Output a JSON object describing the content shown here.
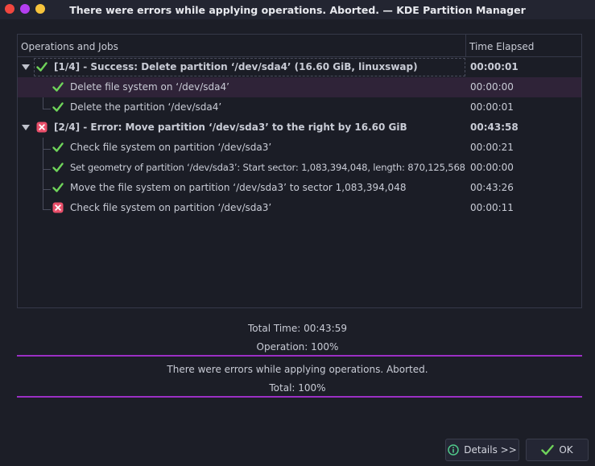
{
  "window": {
    "title": "There were errors while applying operations. Aborted. — KDE Partition Manager"
  },
  "table": {
    "col_operations": "Operations and Jobs",
    "col_time": "Time Elapsed"
  },
  "rows": [
    {
      "text": "[1/4] - Success: Delete partition ‘/dev/sda4’ (16.60 GiB, linuxswap)",
      "time": "00:00:01",
      "status": "success",
      "level": 0
    },
    {
      "text": "Delete file system on ‘/dev/sda4’",
      "time": "00:00:00",
      "status": "success",
      "level": 1
    },
    {
      "text": "Delete the partition ‘/dev/sda4’",
      "time": "00:00:01",
      "status": "success",
      "level": 1
    },
    {
      "text": "[2/4] - Error: Move partition ‘/dev/sda3’ to the right by 16.60 GiB",
      "time": "00:43:58",
      "status": "error",
      "level": 0
    },
    {
      "text": "Check file system on partition ‘/dev/sda3’",
      "time": "00:00:21",
      "status": "success",
      "level": 1
    },
    {
      "text": "Set geometry of partition ‘/dev/sda3’: Start sector: 1,083,394,048, length: 870,125,568",
      "time": "00:00:00",
      "status": "success",
      "level": 1
    },
    {
      "text": "Move the file system on partition ‘/dev/sda3’ to sector 1,083,394,048",
      "time": "00:43:26",
      "status": "success",
      "level": 1
    },
    {
      "text": "Check file system on partition ‘/dev/sda3’",
      "time": "00:00:11",
      "status": "error",
      "level": 1
    }
  ],
  "status": {
    "total_time": "Total Time: 00:43:59",
    "operation_progress": "Operation: 100%",
    "operation_percent": 100,
    "message": "There were errors while applying operations. Aborted.",
    "total_progress": "Total: 100%",
    "total_percent": 100
  },
  "buttons": {
    "details": "Details >>",
    "ok": "OK"
  },
  "colors": {
    "success": "#6fd35a",
    "error": "#e94f6a",
    "accent": "#9b2fc4",
    "selection": "#2f2338"
  },
  "icons": {
    "success": "check-icon",
    "error": "error-x-icon",
    "details": "info-icon",
    "ok": "check-icon"
  }
}
